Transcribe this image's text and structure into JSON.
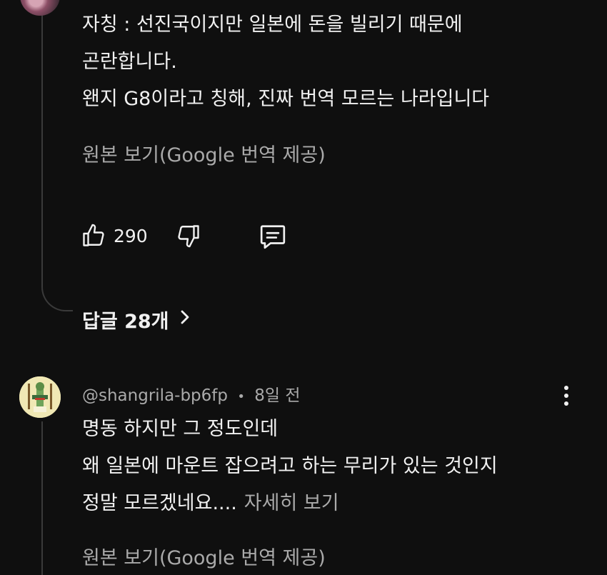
{
  "comment1": {
    "lines": [
      "자칭 : 선진국이지만 일본에 돈을 빌리기 때문에",
      "곤란합니다.",
      "왠지 G8이라고 칭해, 진짜 번역 모르는 나라입니다"
    ],
    "translate_link": "원본 보기(Google 번역 제공)",
    "likes": "290",
    "replies_label": "답글 28개"
  },
  "comment2": {
    "author": "@shangrila-bp6fp",
    "separator": "•",
    "time": "8일 전",
    "lines": [
      "명동  하지만 그 정도인데",
      "왜 일본에 마운트 잡으려고 하는 무리가 있는 것인지",
      "정말 모르겠네요...."
    ],
    "read_more": "자세히 보기",
    "translate_link": "원본 보기(Google 번역 제공)"
  },
  "icons": {
    "like": "thumbs-up-icon",
    "dislike": "thumbs-down-icon",
    "reply": "comment-icon",
    "expand": "chevron-right-icon",
    "more": "more-vert-icon"
  }
}
